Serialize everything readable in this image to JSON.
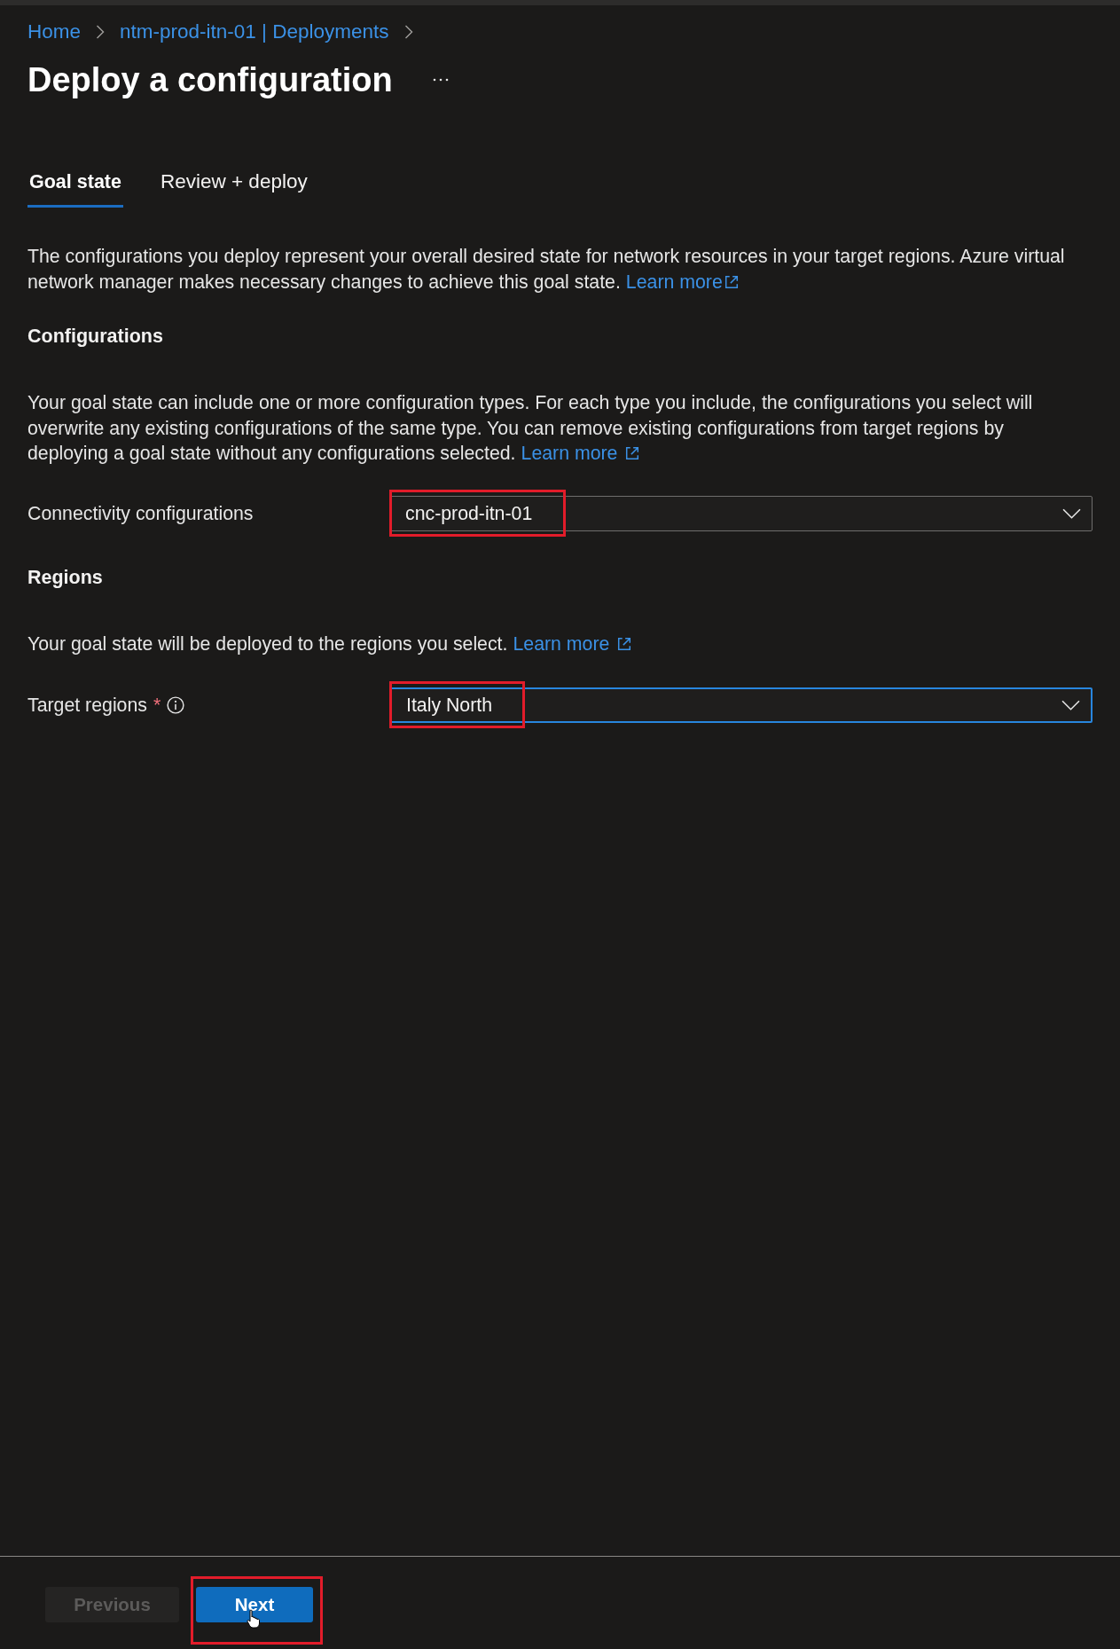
{
  "breadcrumb": [
    {
      "label": "Home"
    },
    {
      "label": "ntm-prod-itn-01 | Deployments"
    }
  ],
  "page": {
    "title": "Deploy a configuration",
    "more_menu": true
  },
  "tabs": [
    {
      "label": "Goal state",
      "selected": true
    },
    {
      "label": "Review + deploy",
      "selected": false
    }
  ],
  "intro": {
    "text": "The configurations you deploy represent your overall desired state for network resources in your target regions. Azure virtual network manager makes necessary changes to achieve this goal state.",
    "link": "Learn more"
  },
  "sections": [
    {
      "heading": "Configurations",
      "description": "Your goal state can include one or more configuration types. For each type you include, the configurations you select will overwrite any existing configurations of the same type. You can remove existing configurations from target regions by deploying a goal state without any configurations selected.",
      "link": "Learn more",
      "fields": [
        {
          "label": "Connectivity configurations",
          "value": "cnc-prod-itn-01",
          "focused": false,
          "highlighted": true
        }
      ]
    },
    {
      "heading": "Regions",
      "description": "Your goal state will be deployed to the regions you select.",
      "link": "Learn more",
      "fields": [
        {
          "label": "Target regions",
          "required_mark": "*",
          "value": "Italy North",
          "info": true,
          "focused": true,
          "highlighted": true
        }
      ]
    }
  ],
  "footer": {
    "buttons": [
      {
        "label": "Previous",
        "kind": "secondary",
        "disabled": true
      },
      {
        "label": "Next",
        "kind": "primary",
        "disabled": false,
        "highlighted": true,
        "pointer": true
      }
    ]
  }
}
